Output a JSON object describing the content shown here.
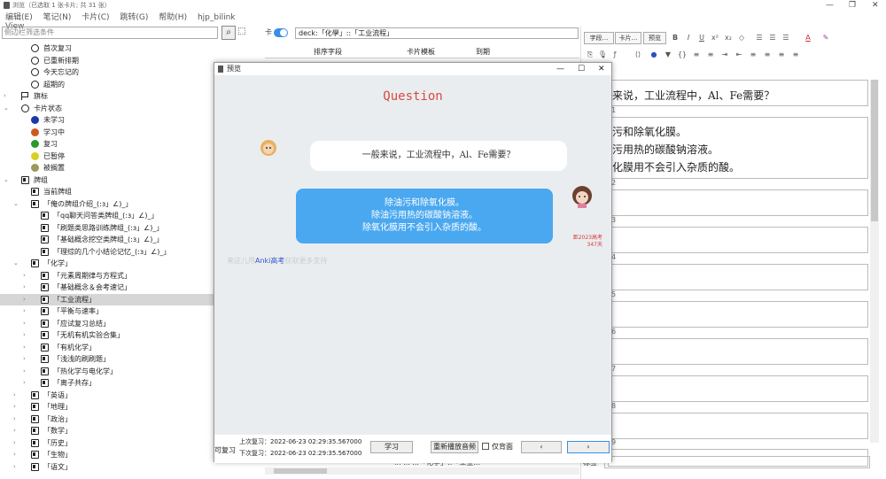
{
  "window": {
    "title": "浏览（已选取 1 张卡片; 共 31 张）"
  },
  "menu": [
    "编辑(E)",
    "笔记(N)",
    "卡片(C)",
    "跳转(G)",
    "帮助(H)",
    "hjp_bilink",
    "View"
  ],
  "sidebar": {
    "search_placeholder": "侧边栏筛选条件",
    "items": [
      {
        "label": "首次复习",
        "indent": 1,
        "icon": "clock-icon"
      },
      {
        "label": "已重新排期",
        "indent": 1,
        "icon": "clock-icon"
      },
      {
        "label": "今天忘记的",
        "indent": 1,
        "icon": "clock-icon"
      },
      {
        "label": "超期的",
        "indent": 1,
        "icon": "clock-icon"
      },
      {
        "label": "旗标",
        "indent": 0,
        "icon": "flag-icon",
        "arrow": "›"
      },
      {
        "label": "卡片状态",
        "indent": 0,
        "icon": "circle-icon",
        "arrow": "⌄"
      },
      {
        "label": "未学习",
        "indent": 1,
        "icon": "dot",
        "color": "#1a3aa8"
      },
      {
        "label": "学习中",
        "indent": 1,
        "icon": "dot",
        "color": "#cc5a1a"
      },
      {
        "label": "复习",
        "indent": 1,
        "icon": "dot",
        "color": "#2a9a2a"
      },
      {
        "label": "已暂停",
        "indent": 1,
        "icon": "dot",
        "color": "#d8d020"
      },
      {
        "label": "被搁置",
        "indent": 1,
        "icon": "dot",
        "color": "#9a9a5a"
      },
      {
        "label": "牌组",
        "indent": 0,
        "icon": "deck-icon",
        "arrow": "⌄"
      },
      {
        "label": "当前牌组",
        "indent": 1,
        "icon": "deck-icon"
      },
      {
        "label": "「俺の牌组介绍_(:з」∠)_」",
        "indent": 1,
        "icon": "deck-icon",
        "arrow": "⌄"
      },
      {
        "label": "「qq聊天问答类牌组_(:з」∠)_」",
        "indent": 2,
        "icon": "deck-icon"
      },
      {
        "label": "「刷题类思路训练牌组_(:з」∠)_」",
        "indent": 2,
        "icon": "deck-icon"
      },
      {
        "label": "「基础概念挖空类牌组_(:з」∠)_」",
        "indent": 2,
        "icon": "deck-icon"
      },
      {
        "label": "「理综的几个小结论记忆_(:з」∠)_」",
        "indent": 2,
        "icon": "deck-icon"
      },
      {
        "label": "「化学」",
        "indent": 1,
        "icon": "deck-icon",
        "arrow": "⌄"
      },
      {
        "label": "「元素周期律与方程式」",
        "indent": 2,
        "icon": "deck-icon",
        "arrow": "›"
      },
      {
        "label": "「基础概念＆会考速记」",
        "indent": 2,
        "icon": "deck-icon",
        "arrow": "›"
      },
      {
        "label": "「工业流程」",
        "indent": 2,
        "icon": "deck-icon",
        "arrow": "›",
        "selected": true
      },
      {
        "label": "「平衡与速率」",
        "indent": 2,
        "icon": "deck-icon",
        "arrow": "›"
      },
      {
        "label": "「应试复习总结」",
        "indent": 2,
        "icon": "deck-icon",
        "arrow": "›"
      },
      {
        "label": "「无机有机实验合集」",
        "indent": 2,
        "icon": "deck-icon",
        "arrow": "›"
      },
      {
        "label": "「有机化学」",
        "indent": 2,
        "icon": "deck-icon",
        "arrow": "›"
      },
      {
        "label": "「浅浅的刷刷题」",
        "indent": 2,
        "icon": "deck-icon",
        "arrow": "›"
      },
      {
        "label": "「热化学与电化学」",
        "indent": 2,
        "icon": "deck-icon",
        "arrow": "›"
      },
      {
        "label": "「离子共存」",
        "indent": 2,
        "icon": "deck-icon",
        "arrow": "›"
      },
      {
        "label": "「英语」",
        "indent": 1,
        "icon": "deck-icon",
        "arrow": "›"
      },
      {
        "label": "「地理」",
        "indent": 1,
        "icon": "deck-icon",
        "arrow": "›"
      },
      {
        "label": "「政治」",
        "indent": 1,
        "icon": "deck-icon",
        "arrow": "›"
      },
      {
        "label": "「数学」",
        "indent": 1,
        "icon": "deck-icon",
        "arrow": "›"
      },
      {
        "label": "「历史」",
        "indent": 1,
        "icon": "deck-icon",
        "arrow": "›"
      },
      {
        "label": "「生物」",
        "indent": 1,
        "icon": "deck-icon",
        "arrow": "›"
      },
      {
        "label": "「语文」",
        "indent": 1,
        "icon": "deck-icon",
        "arrow": "›"
      }
    ]
  },
  "browser": {
    "toggle_label": "卡",
    "search_value": "deck:「化學」::「工业流程」",
    "columns": [
      "排序字段",
      "卡片模板",
      "到期"
    ],
    "bottom_row": "...  ...  ...「化学」::「工业..."
  },
  "editor": {
    "buttons": {
      "fields": "字段...",
      "cards": "卡片...",
      "preview": "预览"
    },
    "format_icons": [
      "B",
      "I",
      "U",
      "x²",
      "x₂",
      "◇",
      "☰",
      "☰",
      "☰",
      "A"
    ],
    "fields": [
      {
        "num": "",
        "value": "来说，工业流程中，Al、Fe需要？"
      },
      {
        "num": "1",
        "value": "污和除氧化膜。\n污用热的碳酸钠溶液。\n化膜用不会引入杂质的酸。"
      },
      {
        "num": "2",
        "value": ""
      },
      {
        "num": "3",
        "value": ""
      },
      {
        "num": "4",
        "value": ""
      },
      {
        "num": "5",
        "value": ""
      },
      {
        "num": "6",
        "value": ""
      },
      {
        "num": "7",
        "value": ""
      },
      {
        "num": "8",
        "value": ""
      },
      {
        "num": "9",
        "value": ""
      }
    ],
    "tags_label": "标签"
  },
  "preview": {
    "title": "预览",
    "heading": "Question",
    "question": "一般来说，工业流程中，Al、Fe需要？",
    "answer_lines": [
      "除油污和除氧化膜。",
      "除油污用热的碳酸钠溶液。",
      "除氧化膜用不会引入杂质的酸。"
    ],
    "countdown_1": "距2023高考",
    "countdown_2": "347天",
    "promo_before": "来这儿用",
    "promo_link": "Anki高考",
    "promo_after": "获取更多支持",
    "bottom_left": "可复习",
    "last_review": "上次复习：2022-06-23 02:29:35.567000",
    "next_review": "下次复习：2022-06-23 02:29:35.567000",
    "btn_learn": "学习",
    "btn_replay": "重新播放音频",
    "chk_back": "仅背面",
    "btn_prev": "‹",
    "btn_next": "›"
  }
}
